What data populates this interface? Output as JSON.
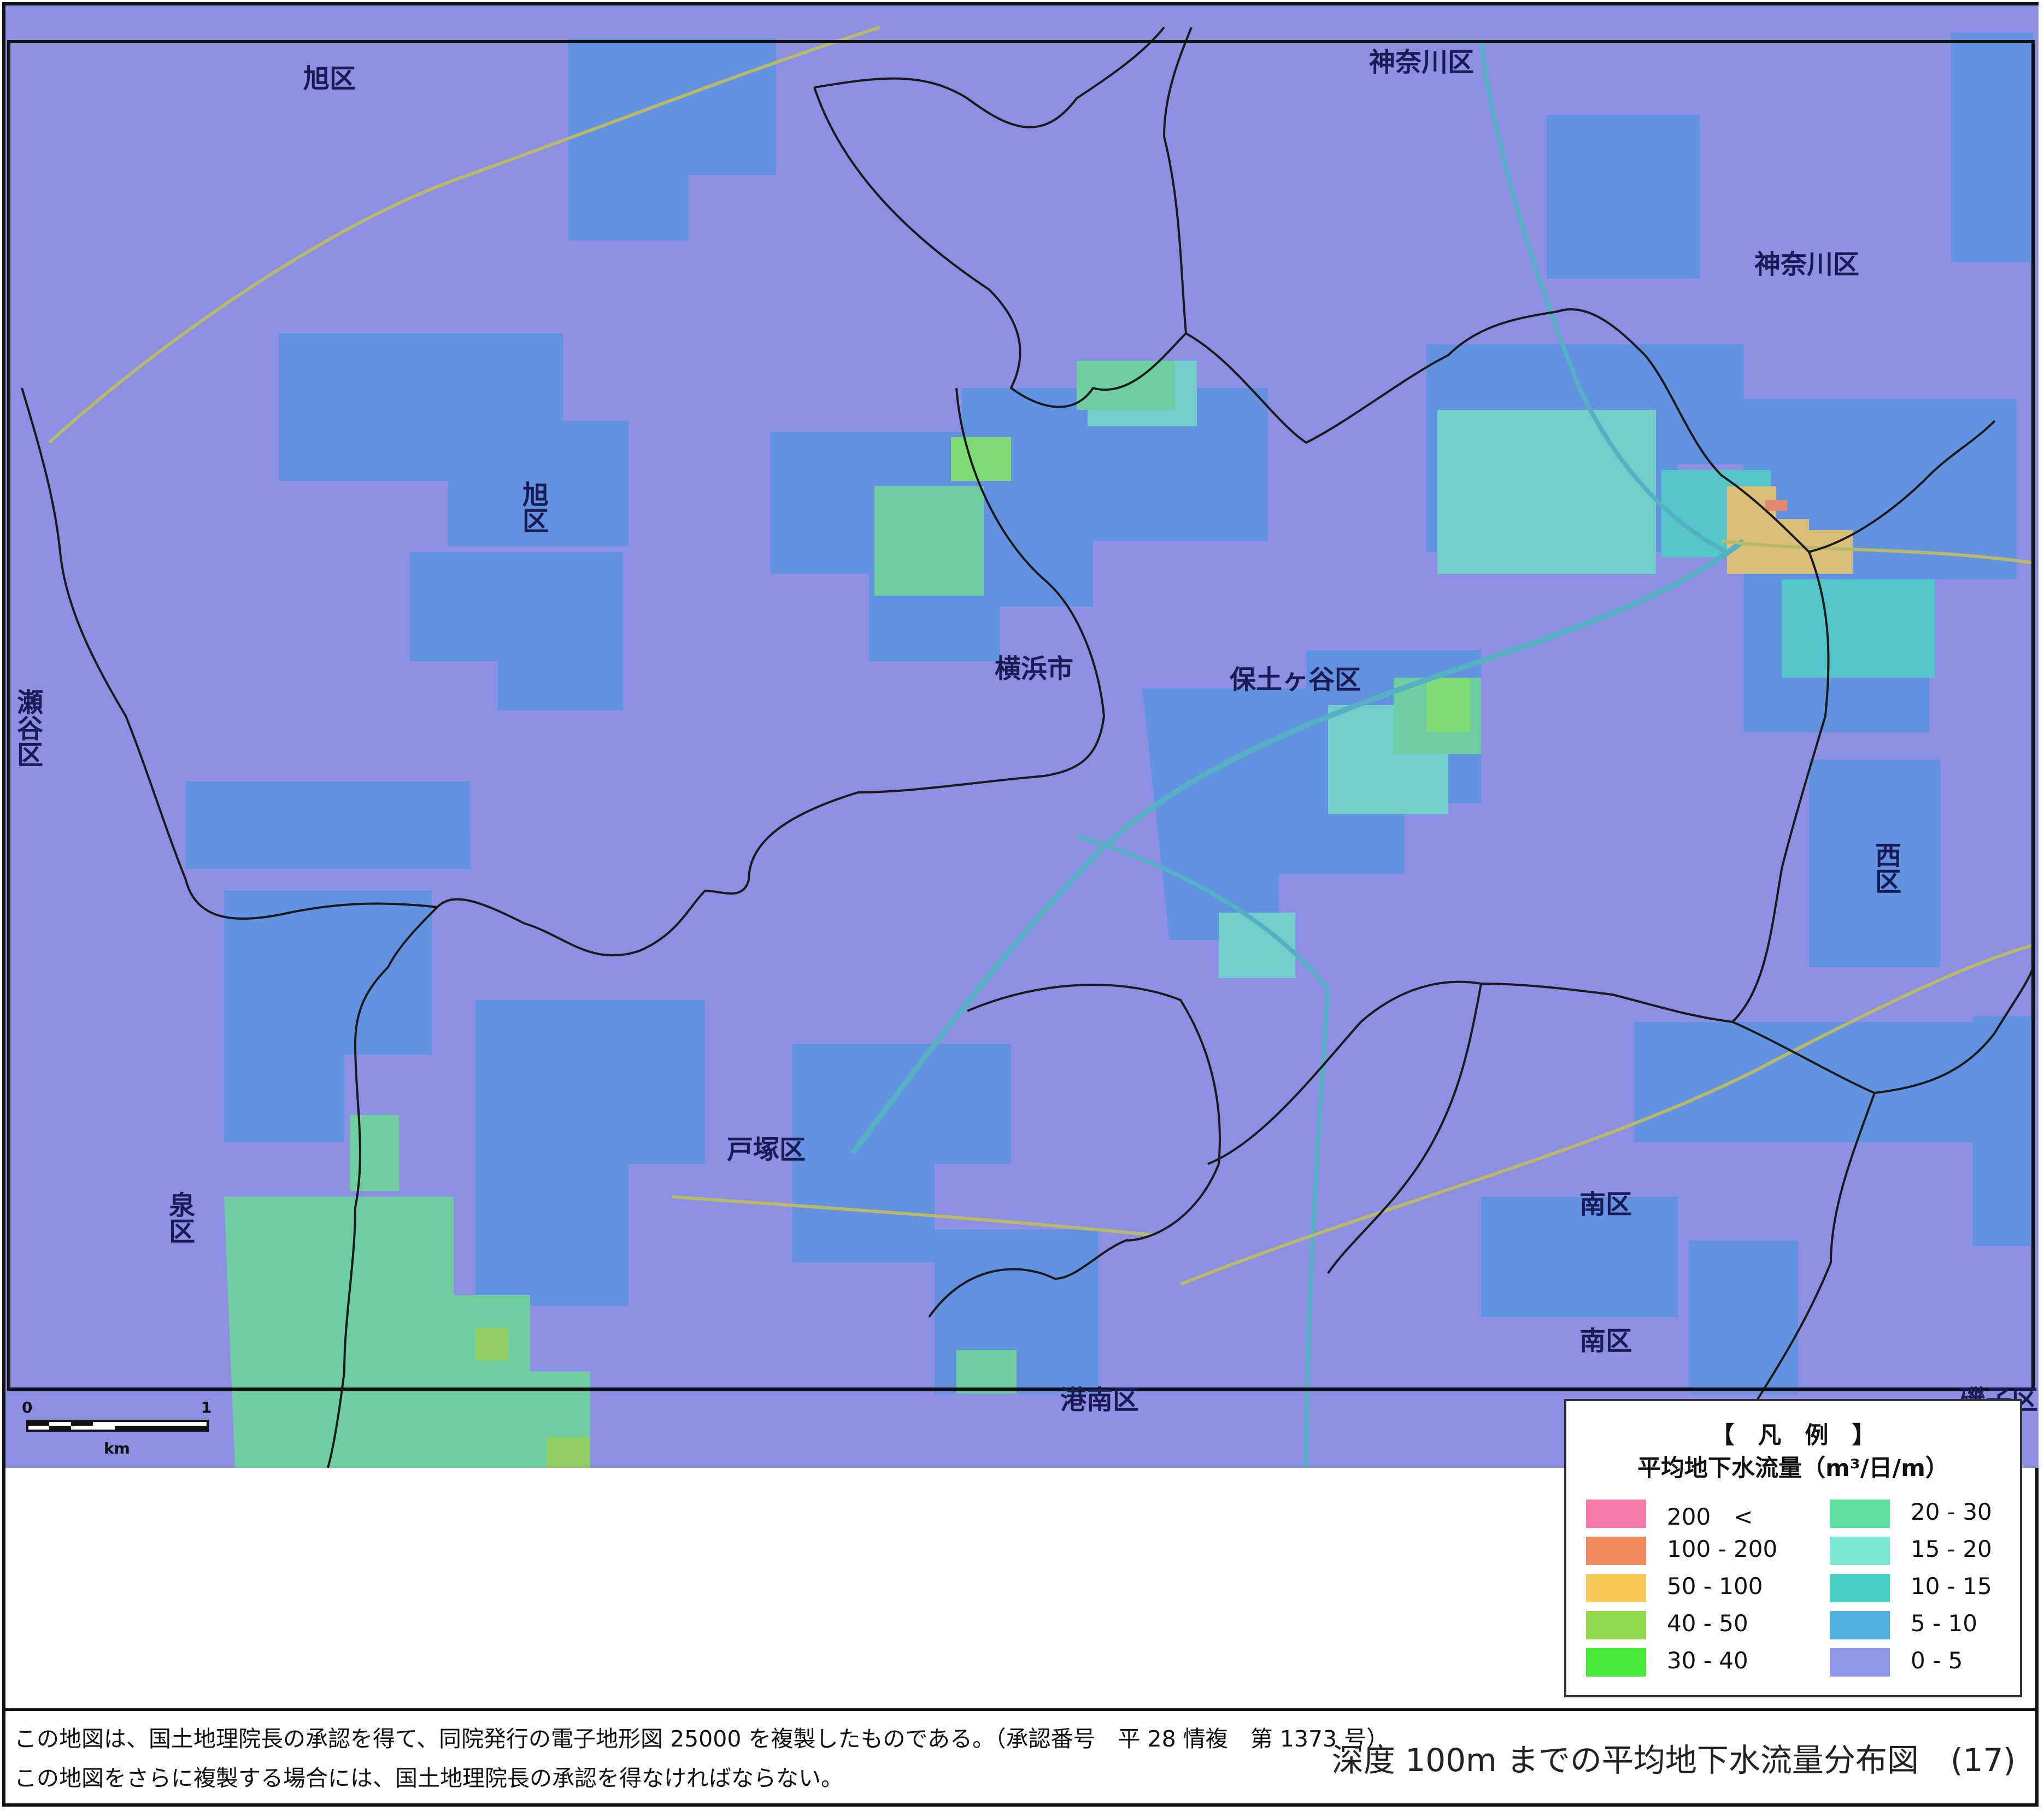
{
  "map": {
    "district_labels": [
      "旭区",
      "神奈川区",
      "神奈川区",
      "旭区",
      "瀬谷区",
      "横浜市",
      "保土ヶ谷区",
      "西区",
      "戸塚区",
      "泉区",
      "南区",
      "南区",
      "港南区",
      "磯子区"
    ],
    "scale_bar": {
      "start_label": "0",
      "end_label": "1",
      "unit_label": "km"
    }
  },
  "legend": {
    "heading": "【　凡　例　】",
    "title": "平均地下水流量（m³/日/m）",
    "items": [
      {
        "label": "200　<",
        "color": "#f77aa8"
      },
      {
        "label": "100 - 200",
        "color": "#f08a5d"
      },
      {
        "label": "50 - 100",
        "color": "#f5c95a"
      },
      {
        "label": "40 - 50",
        "color": "#92d84d"
      },
      {
        "label": "30 - 40",
        "color": "#48e83a"
      },
      {
        "label": "20 - 30",
        "color": "#5fdf9e"
      },
      {
        "label": "15 - 20",
        "color": "#7ae8d3"
      },
      {
        "label": "10 - 15",
        "color": "#4bcfc4"
      },
      {
        "label": "5 - 10",
        "color": "#4fb0e0"
      },
      {
        "label": "0 - 5",
        "color": "#8e97e8"
      }
    ]
  },
  "footer": {
    "note1": "この地図は、国土地理院長の承認を得て、同院発行の電子地形図 25000 を複製したものである。（承認番号　平 28 情複　第 1373 号）",
    "note2": "この地図をさらに複製する場合には、国土地理院長の承認を得なければならない。",
    "title": "深度 100m までの平均地下水流量分布図　(17)"
  }
}
